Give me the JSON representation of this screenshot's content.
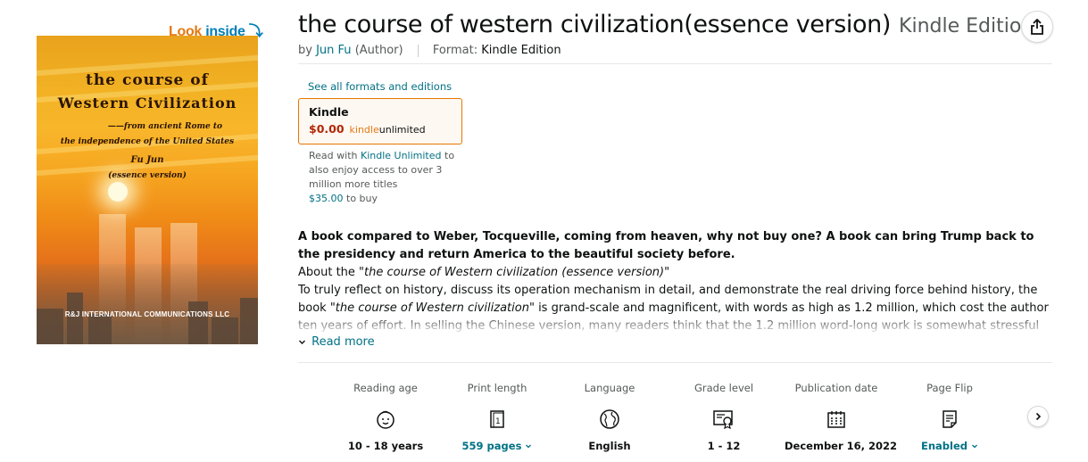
{
  "look_inside": {
    "look": "Look",
    "inside": "inside",
    "arrow": "⤵"
  },
  "cover": {
    "title_line1": "the course of",
    "title_line2": "Western Civilization",
    "subtitle_line1": "——from ancient Rome to",
    "subtitle_line2": "the independence of the United States",
    "author": "Fu Jun",
    "version": "(essence version)",
    "publisher": "R&J INTERNATIONAL COMMUNICATIONS LLC"
  },
  "product": {
    "title": "the course of western civilization(essence version)",
    "edition": "Kindle Edition",
    "by": "by",
    "author": "Jun Fu",
    "author_role": "(Author)",
    "format_label": "Format:",
    "format_value": "Kindle Edition"
  },
  "formats": {
    "see_all": "See all formats and editions",
    "selected": {
      "name": "Kindle",
      "price": "$0.00",
      "ku_kindle": "kindle",
      "ku_unlimited": "unlimited"
    },
    "ku_note_prefix": "Read with",
    "ku_link": "Kindle Unlimited",
    "ku_note_suffix": "to also enjoy access to over 3 million more titles",
    "buy_price": "$35.00",
    "buy_suffix": "to buy"
  },
  "description": {
    "headline": "A book compared to Weber, Tocqueville, coming from heaven, why not buy one? A book can bring Trump back to the presidency and return America to the beautiful society before.",
    "about_prefix": "About the",
    "about_title": "\"the course of Western civilization (essence version)\"",
    "body_part1": "To truly reflect on history, discuss its operation mechanism in detail, and demonstrate the real driving force behind history, the book",
    "body_italic": "\"the course of Western civilization\"",
    "body_part2": "is grand-scale and magnificent, with words as high as 1.2 million, which cost the author ten years of effort. In selling the Chinese version, many readers think that the 1.2 million word-long work is somewhat stressful for readers in",
    "read_more": "Read more"
  },
  "details": [
    {
      "label": "Reading age",
      "icon": "child-face-icon",
      "value": "10 - 18 years",
      "link": false,
      "chevron": false
    },
    {
      "label": "Print length",
      "icon": "document-page-icon",
      "value": "559 pages",
      "link": true,
      "chevron": true
    },
    {
      "label": "Language",
      "icon": "globe-icon",
      "value": "English",
      "link": false,
      "chevron": false
    },
    {
      "label": "Grade level",
      "icon": "certificate-icon",
      "value": "1 - 12",
      "link": false,
      "chevron": false
    },
    {
      "label": "Publication date",
      "icon": "calendar-icon",
      "value": "December 16, 2022",
      "link": false,
      "chevron": false
    },
    {
      "label": "Page Flip",
      "icon": "page-flip-icon",
      "value": "Enabled",
      "link": true,
      "chevron": true
    }
  ],
  "colors": {
    "link": "#007185",
    "price": "#b12704",
    "accent": "#e47911",
    "border_selected": "#e77600"
  }
}
